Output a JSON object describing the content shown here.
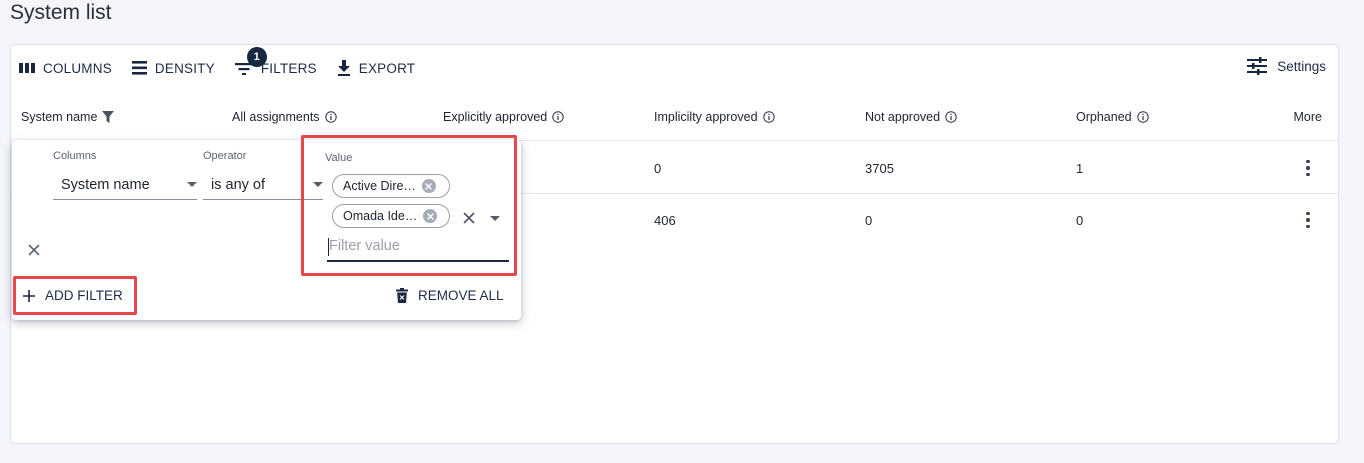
{
  "page": {
    "title": "System list"
  },
  "toolbar": {
    "columns_label": "COLUMNS",
    "density_label": "DENSITY",
    "filters_label": "FILTERS",
    "filters_badge": "1",
    "export_label": "EXPORT",
    "settings_label": "Settings"
  },
  "table": {
    "headers": {
      "system_name": "System name",
      "all_assignments": "All assignments",
      "explicitly_approved": "Explicitly approved",
      "implicitly_approved": "Implicilty approved",
      "not_approved": "Not approved",
      "orphaned": "Orphaned",
      "more": "More"
    },
    "rows": [
      {
        "implicitly_approved": "0",
        "not_approved": "3705",
        "orphaned": "1"
      },
      {
        "implicitly_approved": "406",
        "not_approved": "0",
        "orphaned": "0"
      }
    ]
  },
  "filter_panel": {
    "columns_label": "Columns",
    "columns_value": "System name",
    "operator_label": "Operator",
    "operator_value": "is any of",
    "value_label": "Value",
    "chips": [
      "Active Dire…",
      "Omada Ide…"
    ],
    "input_placeholder": "Filter value",
    "add_filter_label": "ADD FILTER",
    "remove_all_label": "REMOVE ALL"
  },
  "colors": {
    "accent": "#1a2742",
    "highlight": "#e5474c",
    "background": "#f4f6fb"
  },
  "icons": [
    "columns-icon",
    "density-icon",
    "filter-icon",
    "export-icon",
    "settings-icon",
    "funnel-icon",
    "info-icon",
    "more-vert-icon",
    "close-icon",
    "chip-clear-icon",
    "dropdown-caret-icon",
    "plus-icon",
    "trash-icon"
  ]
}
